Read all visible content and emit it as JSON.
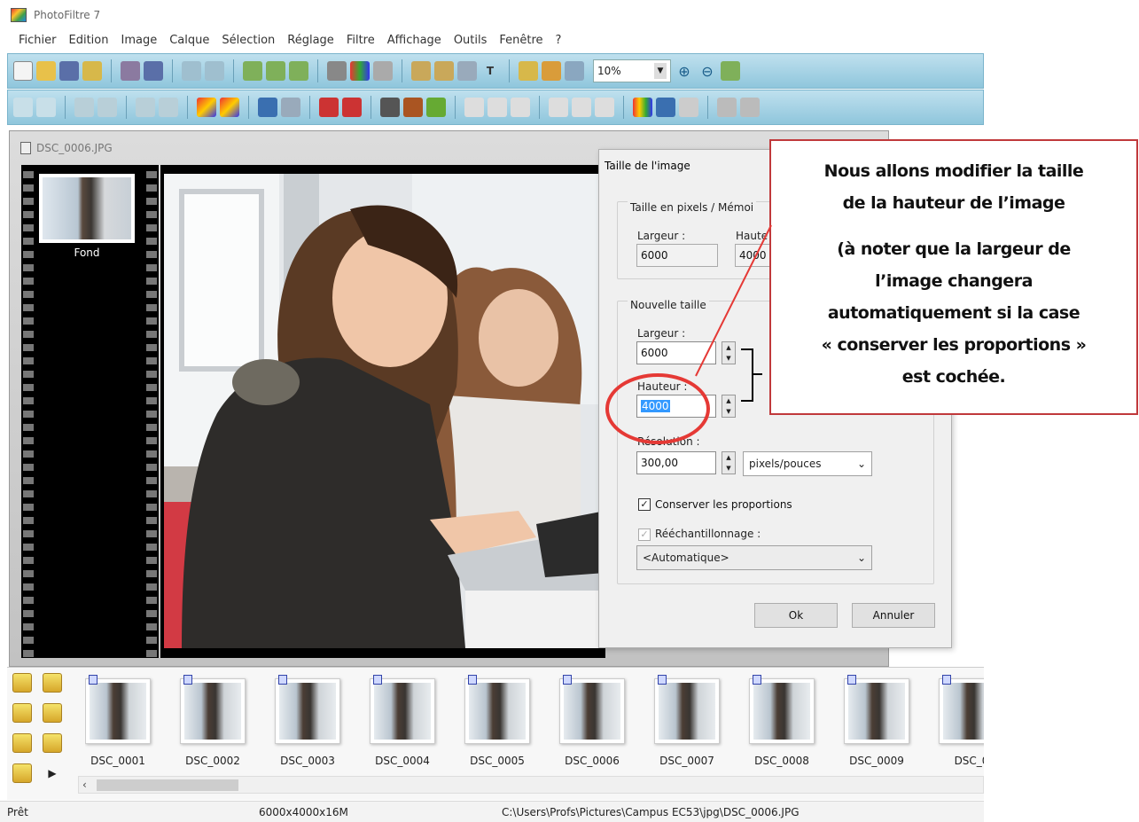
{
  "app": {
    "title": "PhotoFiltre 7"
  },
  "menu": [
    "Fichier",
    "Edition",
    "Image",
    "Calque",
    "Sélection",
    "Réglage",
    "Filtre",
    "Affichage",
    "Outils",
    "Fenêtre",
    "?"
  ],
  "toolbar": {
    "zoom_value": "10%"
  },
  "document": {
    "title": "DSC_0006.JPG",
    "layer_name": "Fond"
  },
  "dialog": {
    "title": "Taille de l'image",
    "group_pixels_label": "Taille en pixels / Mémoi",
    "width_label": "Largeur :",
    "width_value": "6000",
    "height_label_partial": "Haute",
    "height_value_partial": "4000",
    "group_new_label": "Nouvelle taille",
    "new_width_label": "Largeur :",
    "new_width_value": "6000",
    "new_height_label": "Hauteur :",
    "new_height_value": "4000",
    "resolution_label": "Résolution :",
    "resolution_value": "300,00",
    "resolution_unit": "pixels/pouces",
    "keep_proportions_label": "Conserver les proportions",
    "keep_proportions_checked": true,
    "resample_label": "Rééchantillonnage :",
    "resample_value": "<Automatique>",
    "ok_label": "Ok",
    "cancel_label": "Annuler"
  },
  "callout": {
    "line1": "Nous allons modifier la taille",
    "line2": "de la hauteur de l’image",
    "line3": "(à noter que la largeur de",
    "line4": "l’image changera",
    "line5": "automatiquement si la case",
    "line6": "« conserver les proportions »",
    "line7": "est cochée.",
    "color": "#c0393b"
  },
  "filmstrip": {
    "items": [
      "DSC_0001",
      "DSC_0002",
      "DSC_0003",
      "DSC_0004",
      "DSC_0005",
      "DSC_0006",
      "DSC_0007",
      "DSC_0008",
      "DSC_0009",
      "DSC_0"
    ]
  },
  "status": {
    "state": "Prêt",
    "dimensions": "6000x4000x16M",
    "path": "C:\\Users\\Profs\\Pictures\\Campus EC53\\jpg\\DSC_0006.JPG"
  }
}
